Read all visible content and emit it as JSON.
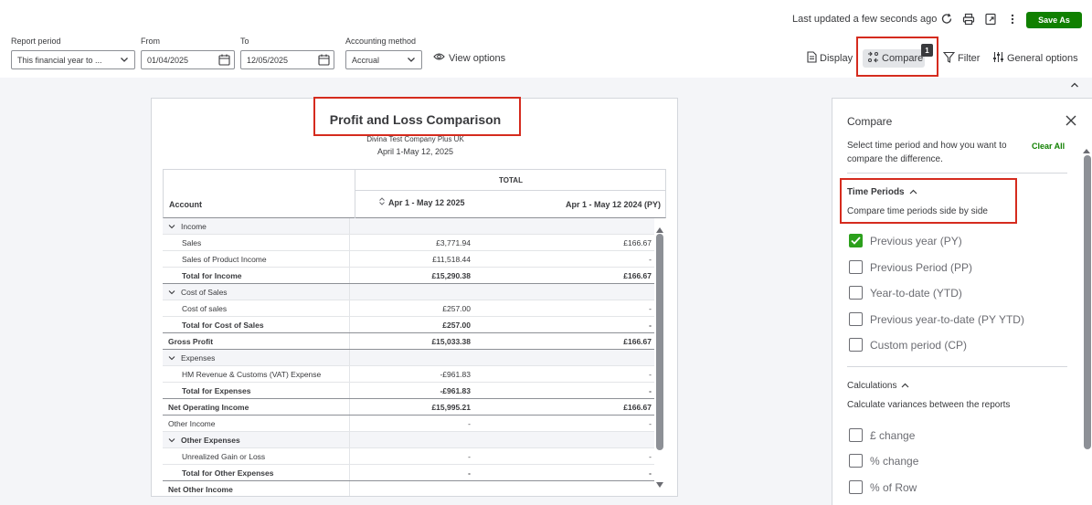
{
  "toolbar": {
    "last_updated": "Last updated a few seconds ago",
    "save_label": "Save As",
    "report_period_label": "Report period",
    "report_period_value": "This financial year to ...",
    "from_label": "From",
    "from_value": "01/04/2025",
    "to_label": "To",
    "to_value": "12/05/2025",
    "method_label": "Accounting method",
    "method_value": "Accrual",
    "view_options": "View options",
    "display": "Display",
    "compare": "Compare",
    "compare_count": "1",
    "filter": "Filter",
    "general_options": "General options"
  },
  "report": {
    "title": "Profit and Loss Comparison",
    "company": "Divina Test Company Plus UK",
    "dates": "April 1-May 12, 2025",
    "total_header": "TOTAL",
    "account_header": "Account",
    "col1_header": "Apr 1 - May 12 2025",
    "col2_header": "Apr 1 - May 12 2024 (PY)",
    "rows": [
      {
        "name": "Income",
        "v1": "",
        "v2": ""
      },
      {
        "name": "Sales",
        "v1": "£3,771.94",
        "v2": "£166.67"
      },
      {
        "name": "Sales of Product Income",
        "v1": "£11,518.44",
        "v2": "-"
      },
      {
        "name": "Total for Income",
        "v1": "£15,290.38",
        "v2": "£166.67"
      },
      {
        "name": "Cost of Sales",
        "v1": "",
        "v2": ""
      },
      {
        "name": "Cost of sales",
        "v1": "£257.00",
        "v2": "-"
      },
      {
        "name": "Total for Cost of Sales",
        "v1": "£257.00",
        "v2": "-"
      },
      {
        "name": "Gross Profit",
        "v1": "£15,033.38",
        "v2": "£166.67"
      },
      {
        "name": "Expenses",
        "v1": "",
        "v2": ""
      },
      {
        "name": "HM Revenue & Customs (VAT) Expense",
        "v1": "-£961.83",
        "v2": "-"
      },
      {
        "name": "Total for Expenses",
        "v1": "-£961.83",
        "v2": "-"
      },
      {
        "name": "Net Operating Income",
        "v1": "£15,995.21",
        "v2": "£166.67"
      },
      {
        "name": "Other Income",
        "v1": "-",
        "v2": "-"
      },
      {
        "name": "Other Expenses",
        "v1": "",
        "v2": ""
      },
      {
        "name": "Unrealized Gain or Loss",
        "v1": "-",
        "v2": "-"
      },
      {
        "name": "Total for Other Expenses",
        "v1": "-",
        "v2": "-"
      },
      {
        "name": "Net Other Income",
        "v1": "",
        "v2": ""
      }
    ]
  },
  "panel": {
    "title": "Compare",
    "description": "Select time period and how you want to compare the difference.",
    "clear_all": "Clear All",
    "time_periods_title": "Time Periods",
    "time_periods_sub": "Compare time periods side by side",
    "options": [
      {
        "label": "Previous year (PY)",
        "checked": true
      },
      {
        "label": "Previous Period (PP)",
        "checked": false
      },
      {
        "label": "Year-to-date (YTD)",
        "checked": false
      },
      {
        "label": "Previous year-to-date (PY YTD)",
        "checked": false
      },
      {
        "label": "Custom period (CP)",
        "checked": false
      }
    ],
    "calculations_title": "Calculations",
    "calculations_sub": "Calculate variances between the reports",
    "calc_options": [
      {
        "label": "£ change",
        "checked": false
      },
      {
        "label": "% change",
        "checked": false
      },
      {
        "label": "% of Row",
        "checked": false
      }
    ]
  },
  "colors": {
    "accent_green": "#108000",
    "check_green": "#2ca01c",
    "highlight_red": "#d52b1e"
  }
}
